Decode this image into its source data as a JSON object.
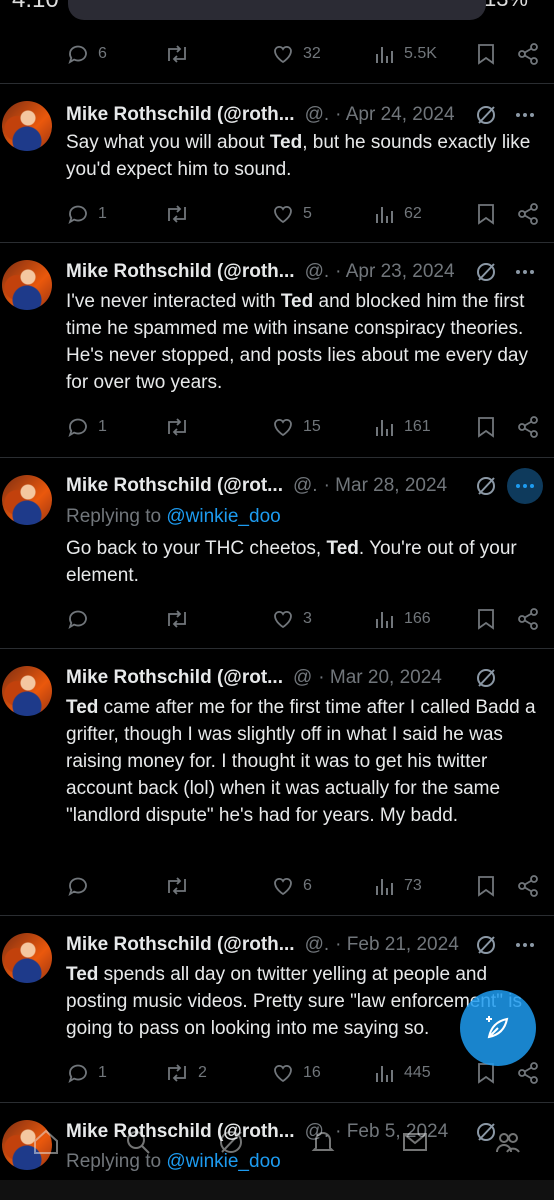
{
  "status_bar": {
    "time": "4:10",
    "battery": "13%"
  },
  "tweets": [
    {
      "stats": {
        "replies": "6",
        "retweets": "",
        "likes": "32",
        "views": "5.5K"
      }
    },
    {
      "name": "Mike Rothschild (@roth...",
      "handle": "@.",
      "date": "· Apr 24, 2024",
      "body_html": "Say what you will about <b>Ted</b>, but he sounds exactly like you'd expect him to sound.",
      "stats": {
        "replies": "1",
        "retweets": "",
        "likes": "5",
        "views": "62"
      }
    },
    {
      "name": "Mike Rothschild (@roth...",
      "handle": "@.",
      "date": "· Apr 23, 2024",
      "body_html": "I've never interacted with <b>Ted</b> and blocked him the first time he spammed me with insane conspiracy theories. He's never stopped, and posts lies about me every day for over two years.",
      "stats": {
        "replies": "1",
        "retweets": "",
        "likes": "15",
        "views": "161"
      }
    },
    {
      "name": "Mike Rothschild (@rot...",
      "handle": "@.",
      "date": "· Mar 28, 2024",
      "reply_prefix": "Replying to ",
      "reply_to": "@winkie_doo",
      "body_html": "Go back to your THC cheetos, <b>Ted</b>. You're out of your element.",
      "stats": {
        "replies": "",
        "retweets": "",
        "likes": "3",
        "views": "166"
      }
    },
    {
      "name": "Mike Rothschild (@rot...",
      "handle": "@",
      "date": "· Mar 20, 2024",
      "body_html": "<b>Ted</b> came after me for the first time after I called Badd a grifter, though I was slightly off in what I said he was raising money for. I thought it was to get his twitter account back (lol) when it was actually for the same \"landlord dispute\" he's had for years. My badd.",
      "stats": {
        "replies": "",
        "retweets": "",
        "likes": "6",
        "views": "73"
      }
    },
    {
      "name": "Mike Rothschild (@roth...",
      "handle": "@.",
      "date": "· Feb 21, 2024",
      "body_html": "<b>Ted</b> spends all day on twitter yelling at people and posting music videos. Pretty sure \"law enforcement\" is going to pass on looking into me saying so.",
      "stats": {
        "replies": "1",
        "retweets": "2",
        "likes": "16",
        "views": "445"
      }
    },
    {
      "name": "Mike Rothschild (@roth...",
      "handle": "@.",
      "date": "· Feb 5, 2024",
      "reply_prefix": "Replying to ",
      "reply_to": "@winkie_doo"
    }
  ],
  "icons": {
    "reply": "reply-icon",
    "retweet": "retweet-icon",
    "like": "heart-icon",
    "views": "views-icon",
    "bookmark": "bookmark-icon",
    "share": "share-icon",
    "grok": "grok-icon",
    "more": "more-icon",
    "compose": "compose-icon"
  },
  "colors": {
    "accent": "#1d9bf0",
    "muted": "#71767b",
    "text": "#e7e9ea",
    "background": "#000000"
  }
}
